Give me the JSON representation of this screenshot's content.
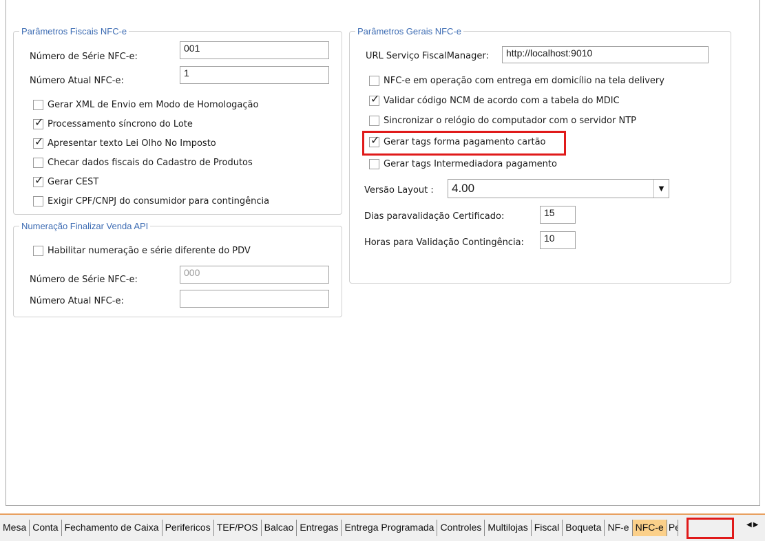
{
  "fiscal_params": {
    "legend": "Parâmetros Fiscais NFC-e",
    "serie_label": "Número de Série NFC-e:",
    "serie_value": "001",
    "atual_label": "Número Atual NFC-e:",
    "atual_value": "1",
    "checkboxes": [
      {
        "label": "Gerar XML de Envio em Modo de Homologação",
        "checked": false
      },
      {
        "label": "Processamento síncrono do Lote",
        "checked": true
      },
      {
        "label": "Apresentar texto Lei Olho No Imposto",
        "checked": true
      },
      {
        "label": "Checar dados fiscais do Cadastro de Produtos",
        "checked": false
      },
      {
        "label": "Gerar CEST",
        "checked": true
      },
      {
        "label": "Exigir CPF/CNPJ do consumidor para contingência",
        "checked": false
      }
    ]
  },
  "api_numbering": {
    "legend": "Numeração Finalizar Venda API",
    "enable_label": "Habilitar numeração e série diferente do PDV",
    "serie_label": "Número de Série NFC-e:",
    "serie_placeholder": "000",
    "atual_label": "Número Atual NFC-e:",
    "atual_value": ""
  },
  "general_params": {
    "legend": "Parâmetros Gerais NFC-e",
    "url_label": "URL Serviço FiscalManager:",
    "url_value": "http://localhost:9010",
    "checkboxes": [
      {
        "label": "NFC-e em operação com entrega em domicílio na tela delivery",
        "checked": false
      },
      {
        "label": "Validar código NCM de acordo com a tabela do MDIC",
        "checked": true
      },
      {
        "label": "Sincronizar o relógio do computador com o servidor NTP",
        "checked": false
      },
      {
        "label": "Gerar tags forma pagamento cartão",
        "checked": true
      },
      {
        "label": "Gerar tags Intermediadora pagamento",
        "checked": false
      }
    ],
    "layout_label": "Versão Layout :",
    "layout_value": "4.00",
    "cert_label": "Dias paravalidação Certificado:",
    "cert_value": "15",
    "cont_label": "Horas para Validação Contingência:",
    "cont_value": "10"
  },
  "tabs": [
    "Mesa",
    "Conta",
    "Fechamento de Caixa",
    "Perifericos",
    "TEF/POS",
    "Balcao",
    "Entregas",
    "Entrega Programada",
    "Controles",
    "Multilojas",
    "Fiscal",
    "Boqueta",
    "NF-e",
    "NFC-e",
    "Pe"
  ],
  "active_tab": "NFC-e",
  "check_glyph": "✓",
  "highlight_color": "#e01a1a"
}
